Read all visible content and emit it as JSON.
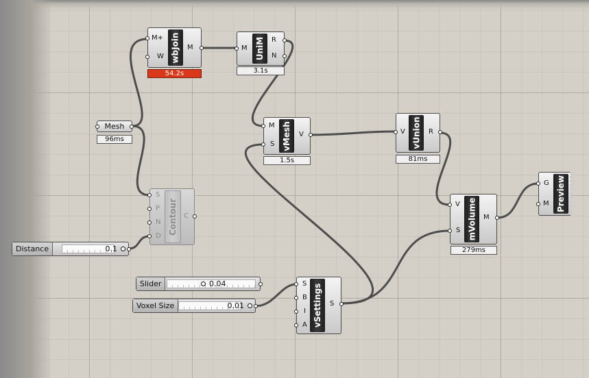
{
  "canvas": {
    "wire_color": "#4d4d4d",
    "timer_slow_color": "#d9391a"
  },
  "components": {
    "wbjoin": {
      "nickname": "wbJoin",
      "inputs": [
        "M+",
        "W"
      ],
      "outputs": [
        "M"
      ],
      "timer": "54.2s"
    },
    "unim": {
      "nickname": "UniM",
      "inputs": [
        "M"
      ],
      "outputs": [
        "R",
        "N"
      ],
      "timer": "3.1s"
    },
    "vmesh": {
      "nickname": "vMesh",
      "inputs": [
        "M",
        "S"
      ],
      "outputs": [
        "V"
      ],
      "timer": "1.5s"
    },
    "vunion": {
      "nickname": "vUnion",
      "inputs": [
        "V"
      ],
      "outputs": [
        "R"
      ],
      "timer": "81ms"
    },
    "contour": {
      "nickname": "Contour",
      "inputs": [
        "S",
        "P",
        "N",
        "D"
      ],
      "outputs": [
        "C"
      ]
    },
    "mvolume": {
      "nickname": "mVolume",
      "inputs": [
        "V",
        "S"
      ],
      "outputs": [
        "M"
      ],
      "timer": "279ms"
    },
    "vsettings": {
      "nickname": "vSettings",
      "inputs": [
        "S",
        "B",
        "I",
        "A"
      ],
      "outputs": [
        "S"
      ]
    },
    "preview": {
      "nickname": "Preview",
      "inputs": [
        "G",
        "M"
      ]
    }
  },
  "params": {
    "mesh": {
      "label": "Mesh",
      "timer": "96ms"
    }
  },
  "sliders": {
    "distance": {
      "label": "Distance",
      "value": "0.1"
    },
    "slider": {
      "label": "Slider",
      "value": "0.04"
    },
    "voxel": {
      "label": "Voxel Size",
      "value": "0.01"
    }
  }
}
